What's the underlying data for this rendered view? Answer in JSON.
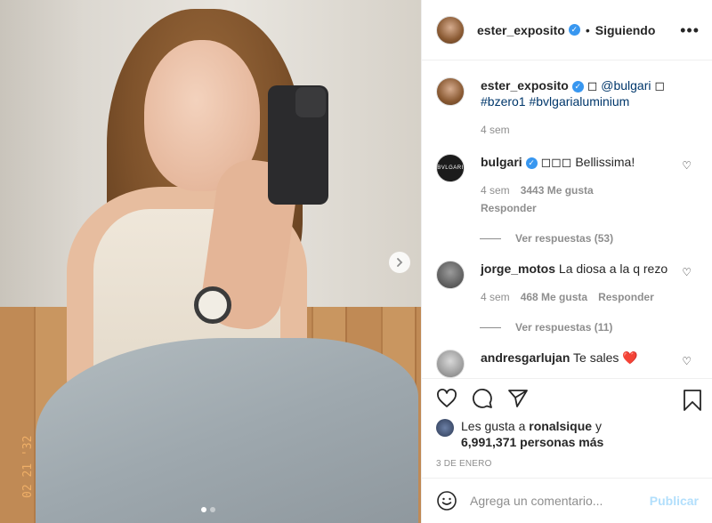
{
  "post": {
    "username": "ester_exposito",
    "follow_dot": "•",
    "follow_label": "Siguiendo",
    "more_label": "•••"
  },
  "caption": {
    "username": "ester_exposito",
    "box": "◻",
    "mention": "@bulgari",
    "box2": "◻",
    "hashtags": "#bzero1 #bvlgarialuminium",
    "time": "4 sem"
  },
  "comments": [
    {
      "username": "bulgari",
      "avatar_text": "BVLGARI",
      "text": "◻◻◻ Bellissima!",
      "time": "4 sem",
      "likes": "3443 Me gusta",
      "reply_label": "Responder",
      "view_replies": "Ver respuestas (53)"
    },
    {
      "username": "jorge_motos",
      "text": "La diosa a la q rezo",
      "time": "4 sem",
      "likes": "468 Me gusta",
      "reply_label": "Responder",
      "view_replies": "Ver respuestas (11)"
    },
    {
      "username": "andresgarlujan",
      "text": "Te sales",
      "emoji": "❤️"
    }
  ],
  "photo": {
    "stamp": "02 21 '32"
  },
  "likes": {
    "prefix": "Les gusta a",
    "user": "ronalsique",
    "conj": "y",
    "count": "6,991,371 personas más"
  },
  "date": "3 DE ENERO",
  "composer": {
    "placeholder": "Agrega un comentario...",
    "publish_label": "Publicar"
  },
  "icons": {
    "like": "heart-icon",
    "comment": "comment-icon",
    "share": "share-icon",
    "save": "bookmark-icon",
    "emoji": "smiley-icon",
    "next": "chevron-right-icon"
  },
  "colors": {
    "verified": "#3897f0",
    "heart": "#ed4956",
    "publish_disabled": "#b2dffc",
    "link": "#00376b"
  }
}
